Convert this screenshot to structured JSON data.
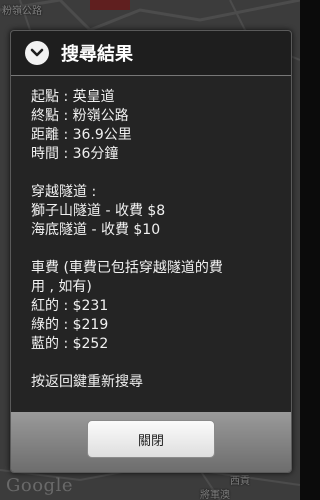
{
  "map": {
    "labels": {
      "top_left": "粉嶺公路",
      "bottom_right": "西貢",
      "bottom_mid": "將軍澳"
    },
    "google_logo": "Google"
  },
  "dialog": {
    "title": "搜尋結果",
    "header_icon": "chevron-down-icon",
    "lines": {
      "origin": "起點 : 英皇道",
      "destination": "終點 : 粉嶺公路",
      "distance": "距離 : 36.9公里",
      "time": "時間 : 36分鐘",
      "tunnels_heading": "穿越隧道 :",
      "tunnel_1": "獅子山隧道 - 收費 $8",
      "tunnel_2": "海底隧道 - 收費 $10",
      "fare_heading_1": "車費 (車費已包括穿越隧道的費",
      "fare_heading_2": "用 , 如有)",
      "fare_red": "紅的 : $231",
      "fare_green": "綠的 : $219",
      "fare_blue": "藍的 : $252",
      "back_hint": "按返回鍵重新搜尋"
    },
    "close_label": "關閉"
  }
}
